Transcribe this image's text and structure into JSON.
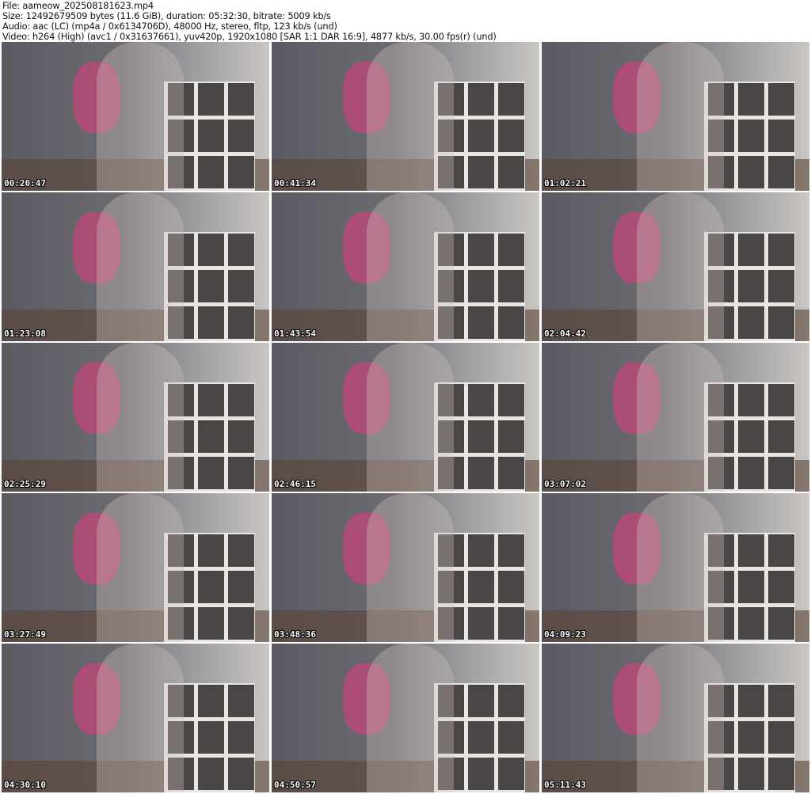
{
  "header": {
    "file": "File: aameow_202508181623.mp4",
    "size": "Size: 12492679509 bytes (11.6 GiB), duration: 05:32:30, bitrate: 5009 kb/s",
    "audio": "Audio: aac (LC) (mp4a / 0x6134706D), 48000 Hz, stereo, fltp, 123 kb/s (und)",
    "video": "Video: h264 (High) (avc1 / 0x31637661), yuv420p, 1920x1080 [SAR 1:1 DAR 16:9], 4877 kb/s, 30.00 fps(r) (und)"
  },
  "thumbnails": [
    {
      "timestamp": "00:20:47"
    },
    {
      "timestamp": "00:41:34"
    },
    {
      "timestamp": "01:02:21"
    },
    {
      "timestamp": "01:23:08"
    },
    {
      "timestamp": "01:43:54"
    },
    {
      "timestamp": "02:04:42"
    },
    {
      "timestamp": "02:25:29"
    },
    {
      "timestamp": "02:46:15"
    },
    {
      "timestamp": "03:07:02"
    },
    {
      "timestamp": "03:27:49"
    },
    {
      "timestamp": "03:48:36"
    },
    {
      "timestamp": "04:09:23"
    },
    {
      "timestamp": "04:30:10"
    },
    {
      "timestamp": "04:50:57"
    },
    {
      "timestamp": "05:11:43"
    }
  ]
}
